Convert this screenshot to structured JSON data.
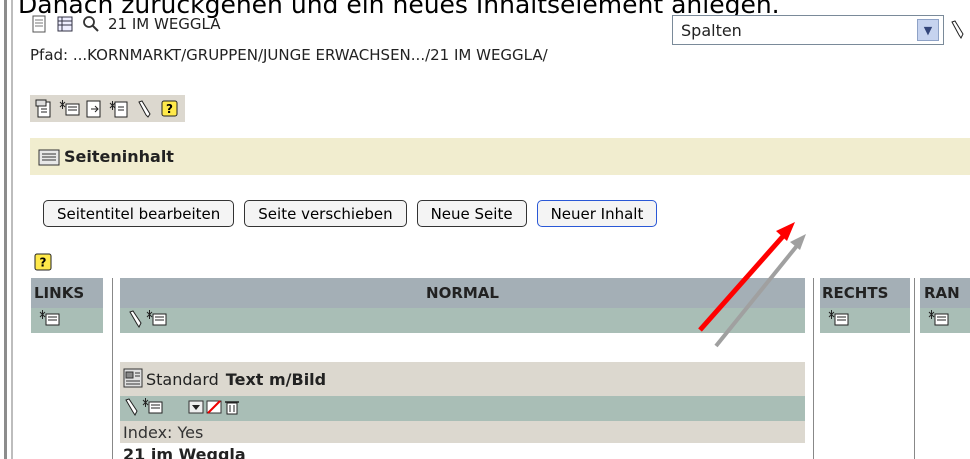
{
  "caption": "Danach zurückgehen und ein neues Inhaltselement anlegen.",
  "page": {
    "title": "21 IM WEGGLA",
    "path": "Pfad: ...KORNMARKT/GRUPPEN/JUNGE ERWACHSEN.../21 IM WEGGLA/"
  },
  "view_select": {
    "value": "Spalten"
  },
  "section": {
    "title": "Seiteninhalt"
  },
  "buttons": {
    "edit_title": "Seitentitel bearbeiten",
    "move_page": "Seite verschieben",
    "new_page": "Neue Seite",
    "new_content": "Neuer Inhalt"
  },
  "columns": {
    "links": "LINKS",
    "normal": "NORMAL",
    "rechts": "RECHTS",
    "rand": "RAN"
  },
  "content_element": {
    "type_label": "Standard",
    "type_name": "Text m/Bild",
    "index": "Index: Yes",
    "title": "21 im Weggla"
  },
  "annotation": {
    "arrow_color": "#ff0000",
    "shadow_arrow_color": "#a0a0a0"
  }
}
